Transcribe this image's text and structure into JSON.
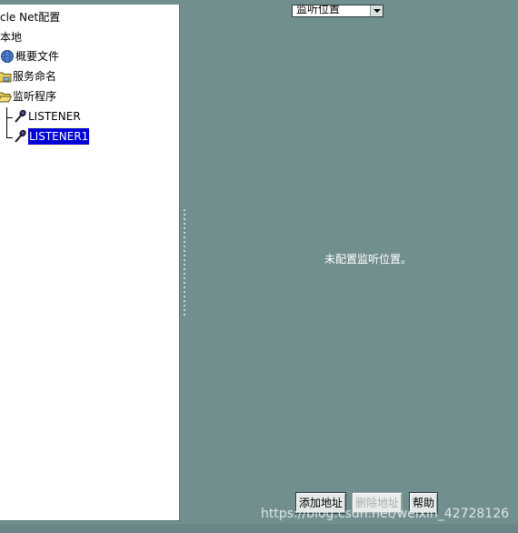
{
  "tree": {
    "root_label": "cle Net配置",
    "local_label": "本地",
    "profile_label": "概要文件",
    "service_naming_label": "服务命名",
    "listeners_label": "监听程序",
    "listener_items": [
      "LISTENER",
      "LISTENER1"
    ],
    "selected_item": "LISTENER1"
  },
  "main": {
    "dropdown_value": "监听位置",
    "empty_message": "未配置监听位置。",
    "buttons": {
      "add_address": "添加地址",
      "remove_address": "删除地址",
      "help": "帮助"
    }
  },
  "watermark": "https://blog.csdn.net/weixin_42728126",
  "colors": {
    "background": "#728f8f",
    "selection": "#0000d8"
  }
}
